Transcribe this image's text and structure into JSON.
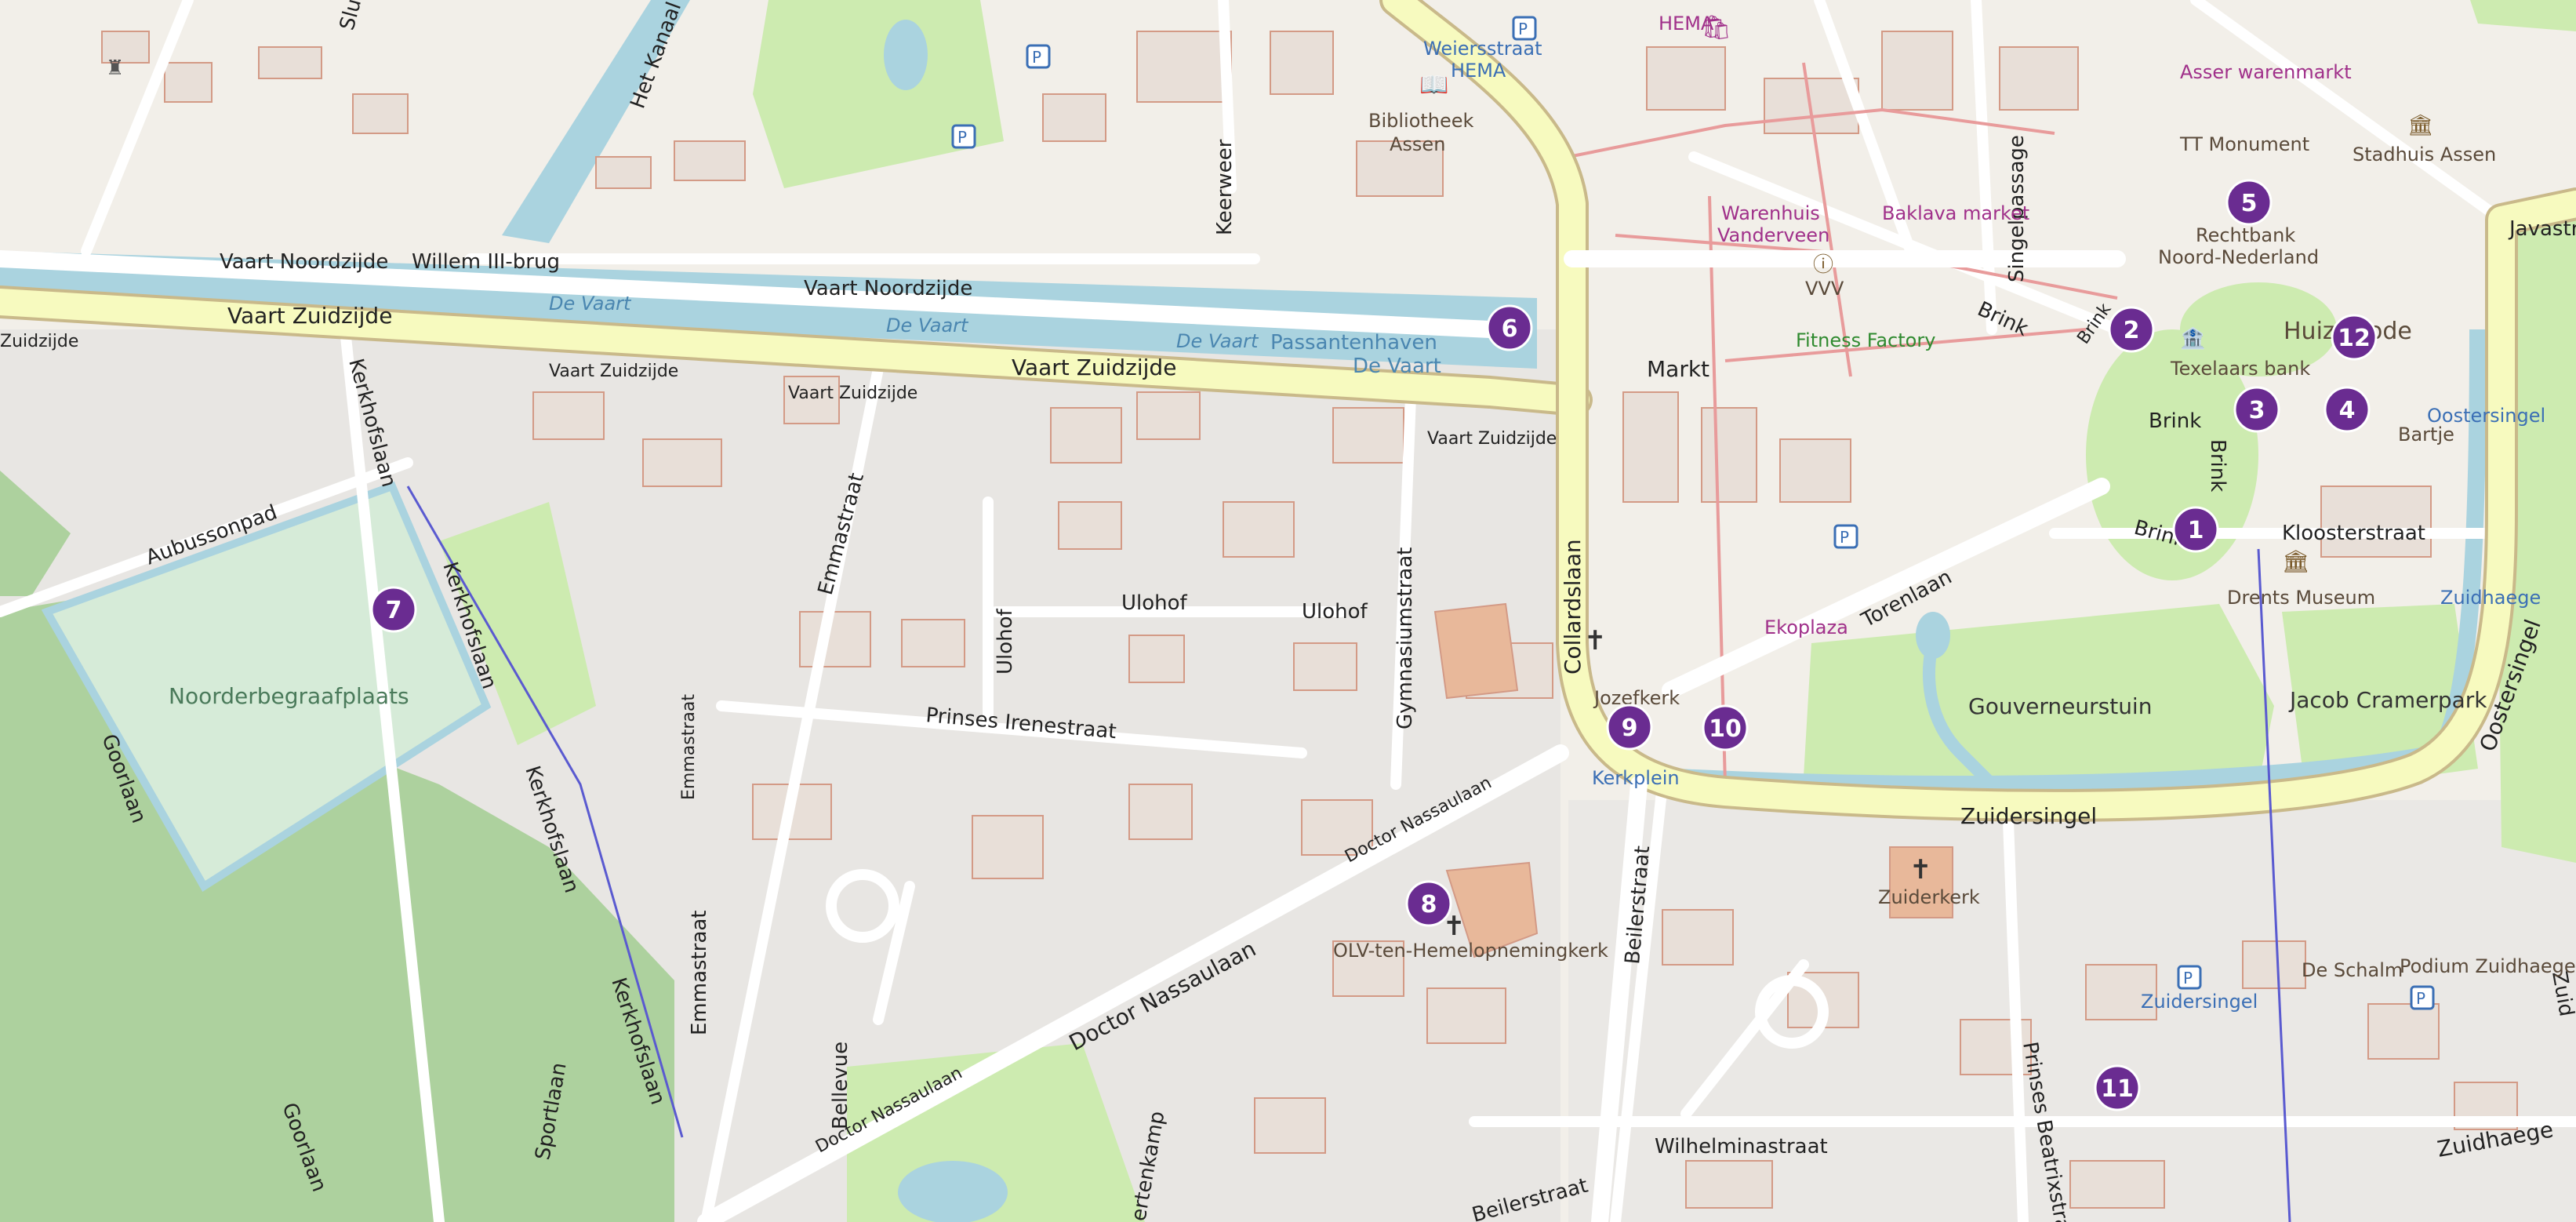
{
  "streets": {
    "vaart_noordzijde_1": "Vaart Noordzijde",
    "vaart_noordzijde_2": "Vaart Noordzijde",
    "vaart_zuidzijde_main": "Vaart Zuidzijde",
    "vaart_zuidzijde_main2": "Vaart Zuidzijde",
    "vaart_zuidzijde_small1": "Vaart Zuidzijde",
    "vaart_zuidzijde_small2": "Vaart Zuidzijde",
    "vaart_zuidzijde_small3": "Vaart Zuidzijde",
    "vaart_zuidzijde_left": "Zuidzijde",
    "willem_brug": "Willem III-brug",
    "het_kanaal": "Het Kanaal",
    "keerweer": "Keerweer",
    "kerkhofslaan_1": "Kerkhofslaan",
    "kerkhofslaan_2": "Kerkhofslaan",
    "kerkhofslaan_3": "Kerkhofslaan",
    "kerkhofslaan_4": "Kerkhofslaan",
    "aubussonpad": "Aubussonpad",
    "emmastraat_1": "Emmastraat",
    "emmastraat_2": "Emmastraat",
    "emmastraat_3": "Emmastraat",
    "goorlaan_1": "Goorlaan",
    "goorlaan_2": "Goorlaan",
    "sportlaan": "Sportlaan",
    "ulohof_1": "Ulohof",
    "ulohof_2": "Ulohof",
    "ulohof_3": "Ulohof",
    "prinses_irenestraat": "Prinses Irenestraat",
    "gymnasiumstraat": "Gymnasiumstraat",
    "collardslaan": "Collardslaan",
    "doctor_nassaulaan_1": "Doctor Nassaulaan",
    "doctor_nassaulaan_2": "Doctor Nassaulaan",
    "doctor_nassaulaan_3": "Doctor Nassaulaan",
    "bellevue": "Bellevue",
    "beilerstraat": "Beilerstraat",
    "beilerstraat_2": "Beilerstraat",
    "torenlaan": "Torenlaan",
    "zuidersingel": "Zuidersingel",
    "oostersingel": "Oostersingel",
    "javastraat": "Javastraat",
    "singelpassage": "Singelpassage",
    "brink_1": "Brink",
    "brink_2": "Brink",
    "brink_3": "Brink",
    "brink_4": "Brink",
    "brink_5": "Brink",
    "kloosterstraat": "Kloosterstraat",
    "markt": "Markt",
    "wilhelminastraat": "Wilhelminastraat",
    "prinses_beatrixstraat": "Prinses Beatrixstraat",
    "zuidhaege_street": "Zuidhaege",
    "zuid": "Zuid",
    "slu": "Slu",
    "ertenkamp": "ertenkamp"
  },
  "water": {
    "de_vaart_1": "De Vaart",
    "de_vaart_2": "De Vaart",
    "de_vaart_3": "De Vaart",
    "passantenhaven": "Passantenhaven",
    "passantenhaven_2": "De Vaart"
  },
  "pois": {
    "weiersstraat_hema": "Weiersstraat",
    "weiersstraat_hema_2": "HEMA",
    "hema": "HEMA",
    "bibliotheek": "Bibliotheek",
    "bibliotheek_2": "Assen",
    "warenhuis": "Warenhuis",
    "warenhuis_2": "Vanderveen",
    "baklava": "Baklava market",
    "vvv": "VVV",
    "fitness": "Fitness Factory",
    "asser_warenmarkt": "Asser warenmarkt",
    "tt_monument": "TT Monument",
    "stadhuis": "Stadhuis Assen",
    "rechtbank": "Rechtbank",
    "rechtbank_2": "Noord-Nederland",
    "texelaars": "Texelaars bank",
    "huize": "Huize",
    "huize_2": "ode",
    "bartje": "Bartje",
    "oostersingel_bus": "Oostersingel",
    "zuidhaege_bus": "Zuidhaege",
    "drents_museum": "Drents Museum",
    "jozefkerk": "Jozefkerk",
    "kerkplein": "Kerkplein",
    "ekoplaza": "Ekoplaza",
    "gouverneurstuin": "Gouverneurstuin",
    "jacob_cramerpark": "Jacob Cramerpark",
    "zuiderkerk": "Zuiderkerk",
    "olv": "OLV-ten-Hemelopnemingkerk",
    "zuidersingel_parking": "Zuidersingel",
    "de_schalm": "De Schalm",
    "podium": "Podium Zuidhaege",
    "noorderbegraafplaats": "Noorderbegraafplaats"
  },
  "markers": [
    {
      "num": "1"
    },
    {
      "num": "2"
    },
    {
      "num": "3"
    },
    {
      "num": "4"
    },
    {
      "num": "5"
    },
    {
      "num": "6"
    },
    {
      "num": "7"
    },
    {
      "num": "8"
    },
    {
      "num": "9"
    },
    {
      "num": "10"
    },
    {
      "num": "11"
    },
    {
      "num": "12"
    }
  ],
  "colors": {
    "background": "#f2efe9",
    "water": "#aad3df",
    "park": "#cdebb0",
    "forest": "#add19e",
    "cemetery": "#d6ebd8",
    "primary_road": "#f7fabf",
    "building": "#d9d0c9",
    "marker": "#6a2c91"
  }
}
